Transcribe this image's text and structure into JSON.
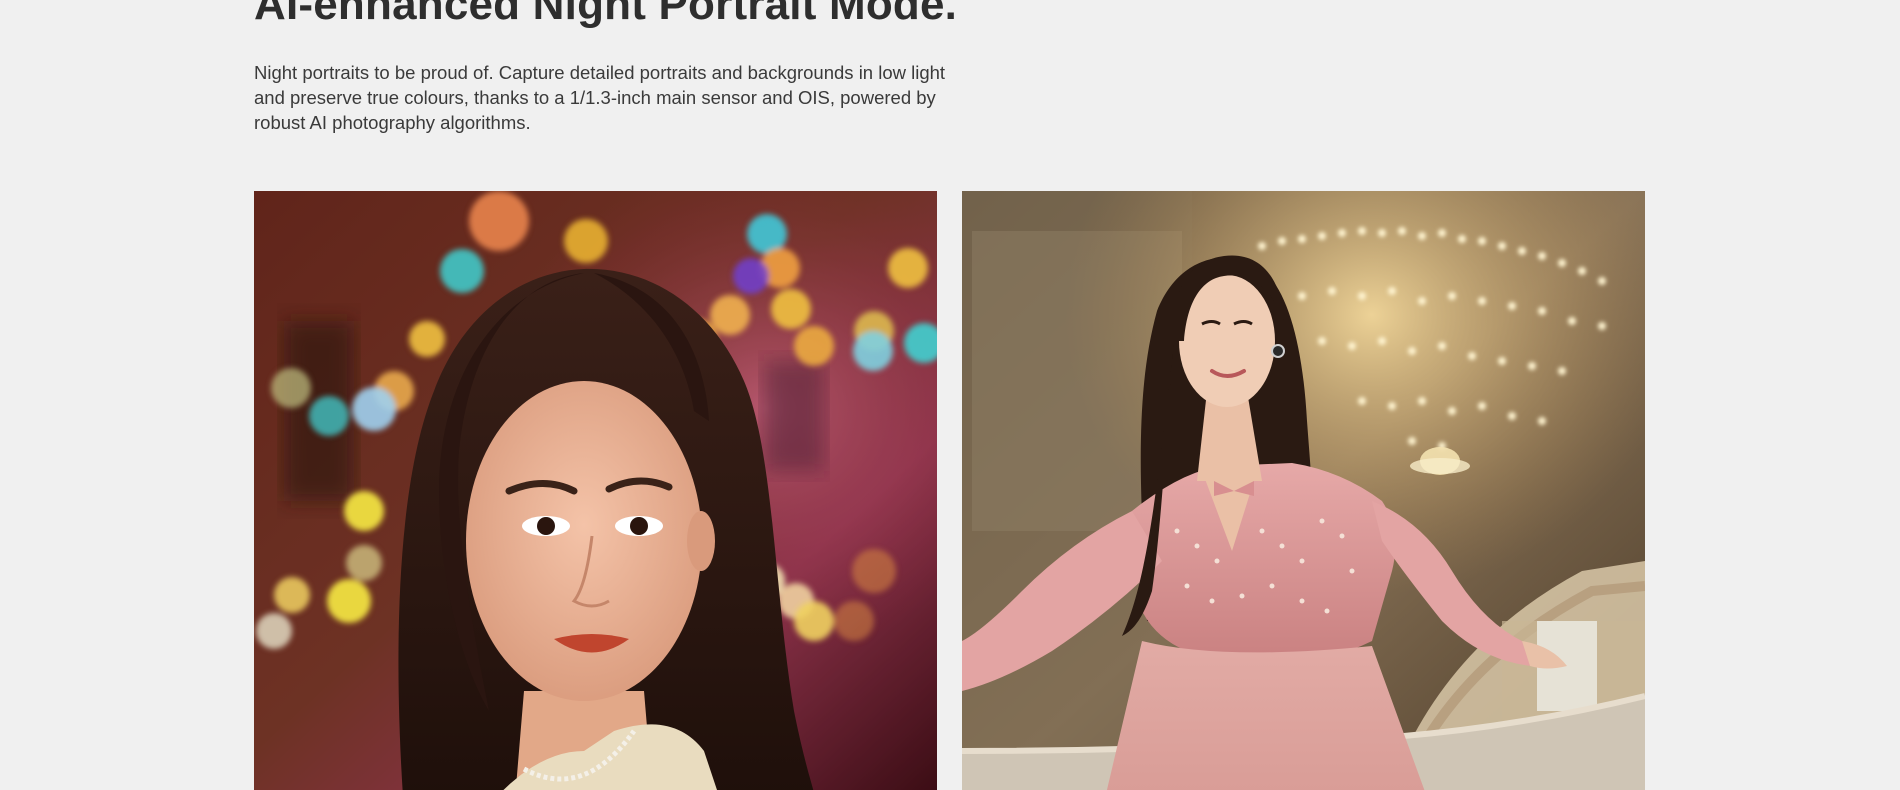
{
  "section": {
    "title": "AI-enhanced Night Portrait Mode.",
    "description": "Night portraits to be proud of. Capture detailed portraits and backgrounds in low light and preserve true colours, thanks to a 1/1.3-inch main sensor and OIS, powered by robust AI photography algorithms."
  },
  "photos": [
    {
      "name": "night-portrait-bokeh-photo"
    },
    {
      "name": "portrait-chandelier-photo"
    }
  ],
  "colors": {
    "background": "#f0f0f0",
    "text": "#333333"
  }
}
